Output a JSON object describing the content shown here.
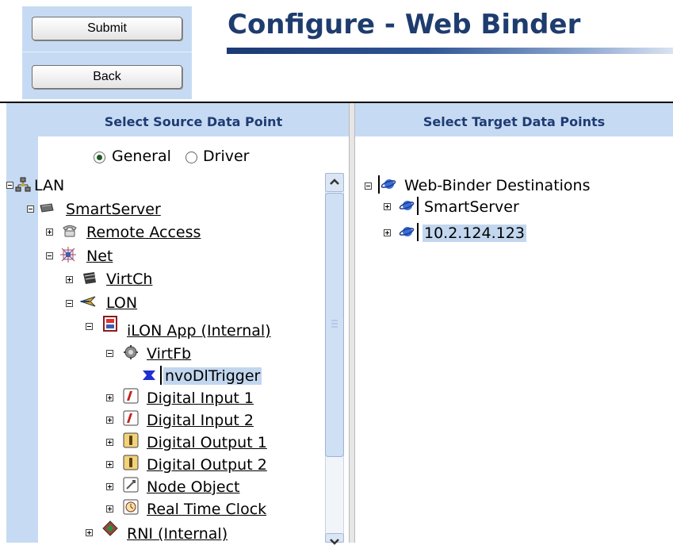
{
  "header": {
    "submit_label": "Submit",
    "back_label": "Back",
    "title": "Configure - Web Binder"
  },
  "left_panel": {
    "title": "Select Source Data Point",
    "radio": {
      "general_label": "General",
      "driver_label": "Driver",
      "selected": "General"
    },
    "tree": {
      "lan": "LAN",
      "smartserver": "SmartServer",
      "remote_access": "Remote Access",
      "net": "Net",
      "virtch": "VirtCh",
      "lon": "LON",
      "ilon_app": "iLON App (Internal)",
      "virtfb": "VirtFb",
      "nvodltrigger": "nvoDlTrigger",
      "digital_input_1": "Digital Input 1",
      "digital_input_2": "Digital Input 2",
      "digital_output_1": "Digital Output 1",
      "digital_output_2": "Digital Output 2",
      "node_object": "Node Object",
      "real_time_clock": "Real Time Clock",
      "rni": "RNI (Internal)"
    }
  },
  "right_panel": {
    "title": "Select Target Data Points",
    "tree": {
      "root": "Web-Binder Destinations",
      "smartserver": "SmartServer",
      "ip": "10.2.124.123"
    }
  },
  "colors": {
    "panel_bg": "#c6dbf3",
    "title_color": "#1e3c6e",
    "header_text": "#1f3b73",
    "selection_bg": "#c2d6ee"
  }
}
